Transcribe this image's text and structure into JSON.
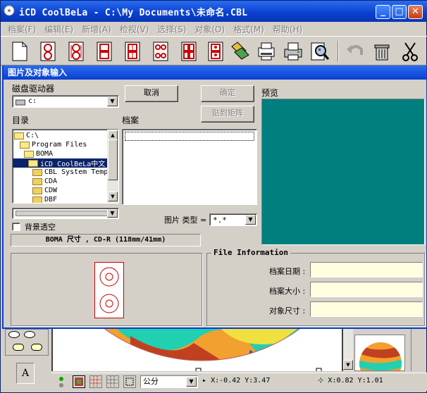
{
  "window": {
    "title": "iCD CoolBeLa - C:\\My Documents\\未命名.CBL",
    "minimize": "_",
    "maximize": "□",
    "close": "✕"
  },
  "menu": [
    "档案(F)",
    "编辑(E)",
    "新增(A)",
    "检视(V)",
    "选择(S)",
    "对象(O)",
    "格式(M)",
    "帮助(H)"
  ],
  "toolbar": [
    {
      "name": "new-document-icon"
    },
    {
      "name": "label-layout-1-icon"
    },
    {
      "name": "label-layout-2-icon"
    },
    {
      "name": "label-layout-3-icon"
    },
    {
      "name": "label-layout-4-icon"
    },
    {
      "name": "label-layout-5-icon"
    },
    {
      "name": "label-layout-6-icon"
    },
    {
      "name": "label-layout-7-icon"
    },
    {
      "name": "image-insert-icon"
    },
    {
      "name": "print-setup-icon"
    },
    {
      "name": "printer-icon"
    },
    {
      "name": "print-preview-icon"
    },
    {
      "name": "undo-icon"
    },
    {
      "name": "trash-icon"
    },
    {
      "name": "scissors-icon"
    }
  ],
  "dialog": {
    "title": "图片及对象输入",
    "drive_label": "磁盘驱动器",
    "drive_value": "c:",
    "cancel": "取消",
    "ok": "确定",
    "fit": "贴到矩阵",
    "preview_label": "预览",
    "dir_label": "目录",
    "file_label": "档案",
    "tree": [
      {
        "text": "C:\\",
        "level": 0
      },
      {
        "text": "Program Files",
        "level": 1
      },
      {
        "text": "BOMA",
        "level": 2
      },
      {
        "text": "iCD CoolBeLa中文",
        "level": 3,
        "selected": true
      },
      {
        "text": "CBL System Temp",
        "level": 4
      },
      {
        "text": "CDA",
        "level": 4
      },
      {
        "text": "CDW",
        "level": 4
      },
      {
        "text": "DBF",
        "level": 4
      }
    ],
    "type_label": "图片 类型 =",
    "type_value": "*.*",
    "transparent_label": "背景透空",
    "size_text": "BOMA 尺寸 , CD-R (118mm/41mm)",
    "file_info_title": "File Information",
    "file_date_label": "档案日期 :",
    "file_size_label": "档案大小 :",
    "object_size_label": "对象尺寸 :",
    "file_date_value": "",
    "file_size_value": "",
    "object_size_value": ""
  },
  "statusbar": {
    "unit": "公分",
    "cursor": "X:-0.42 Y:3.47",
    "size": "X:0.82 Y:1.01",
    "text_tool": "A"
  },
  "colors": {
    "title_blue": "#0a3fd0",
    "preview_teal": "#007f7f",
    "face": "#d4d0c8"
  }
}
